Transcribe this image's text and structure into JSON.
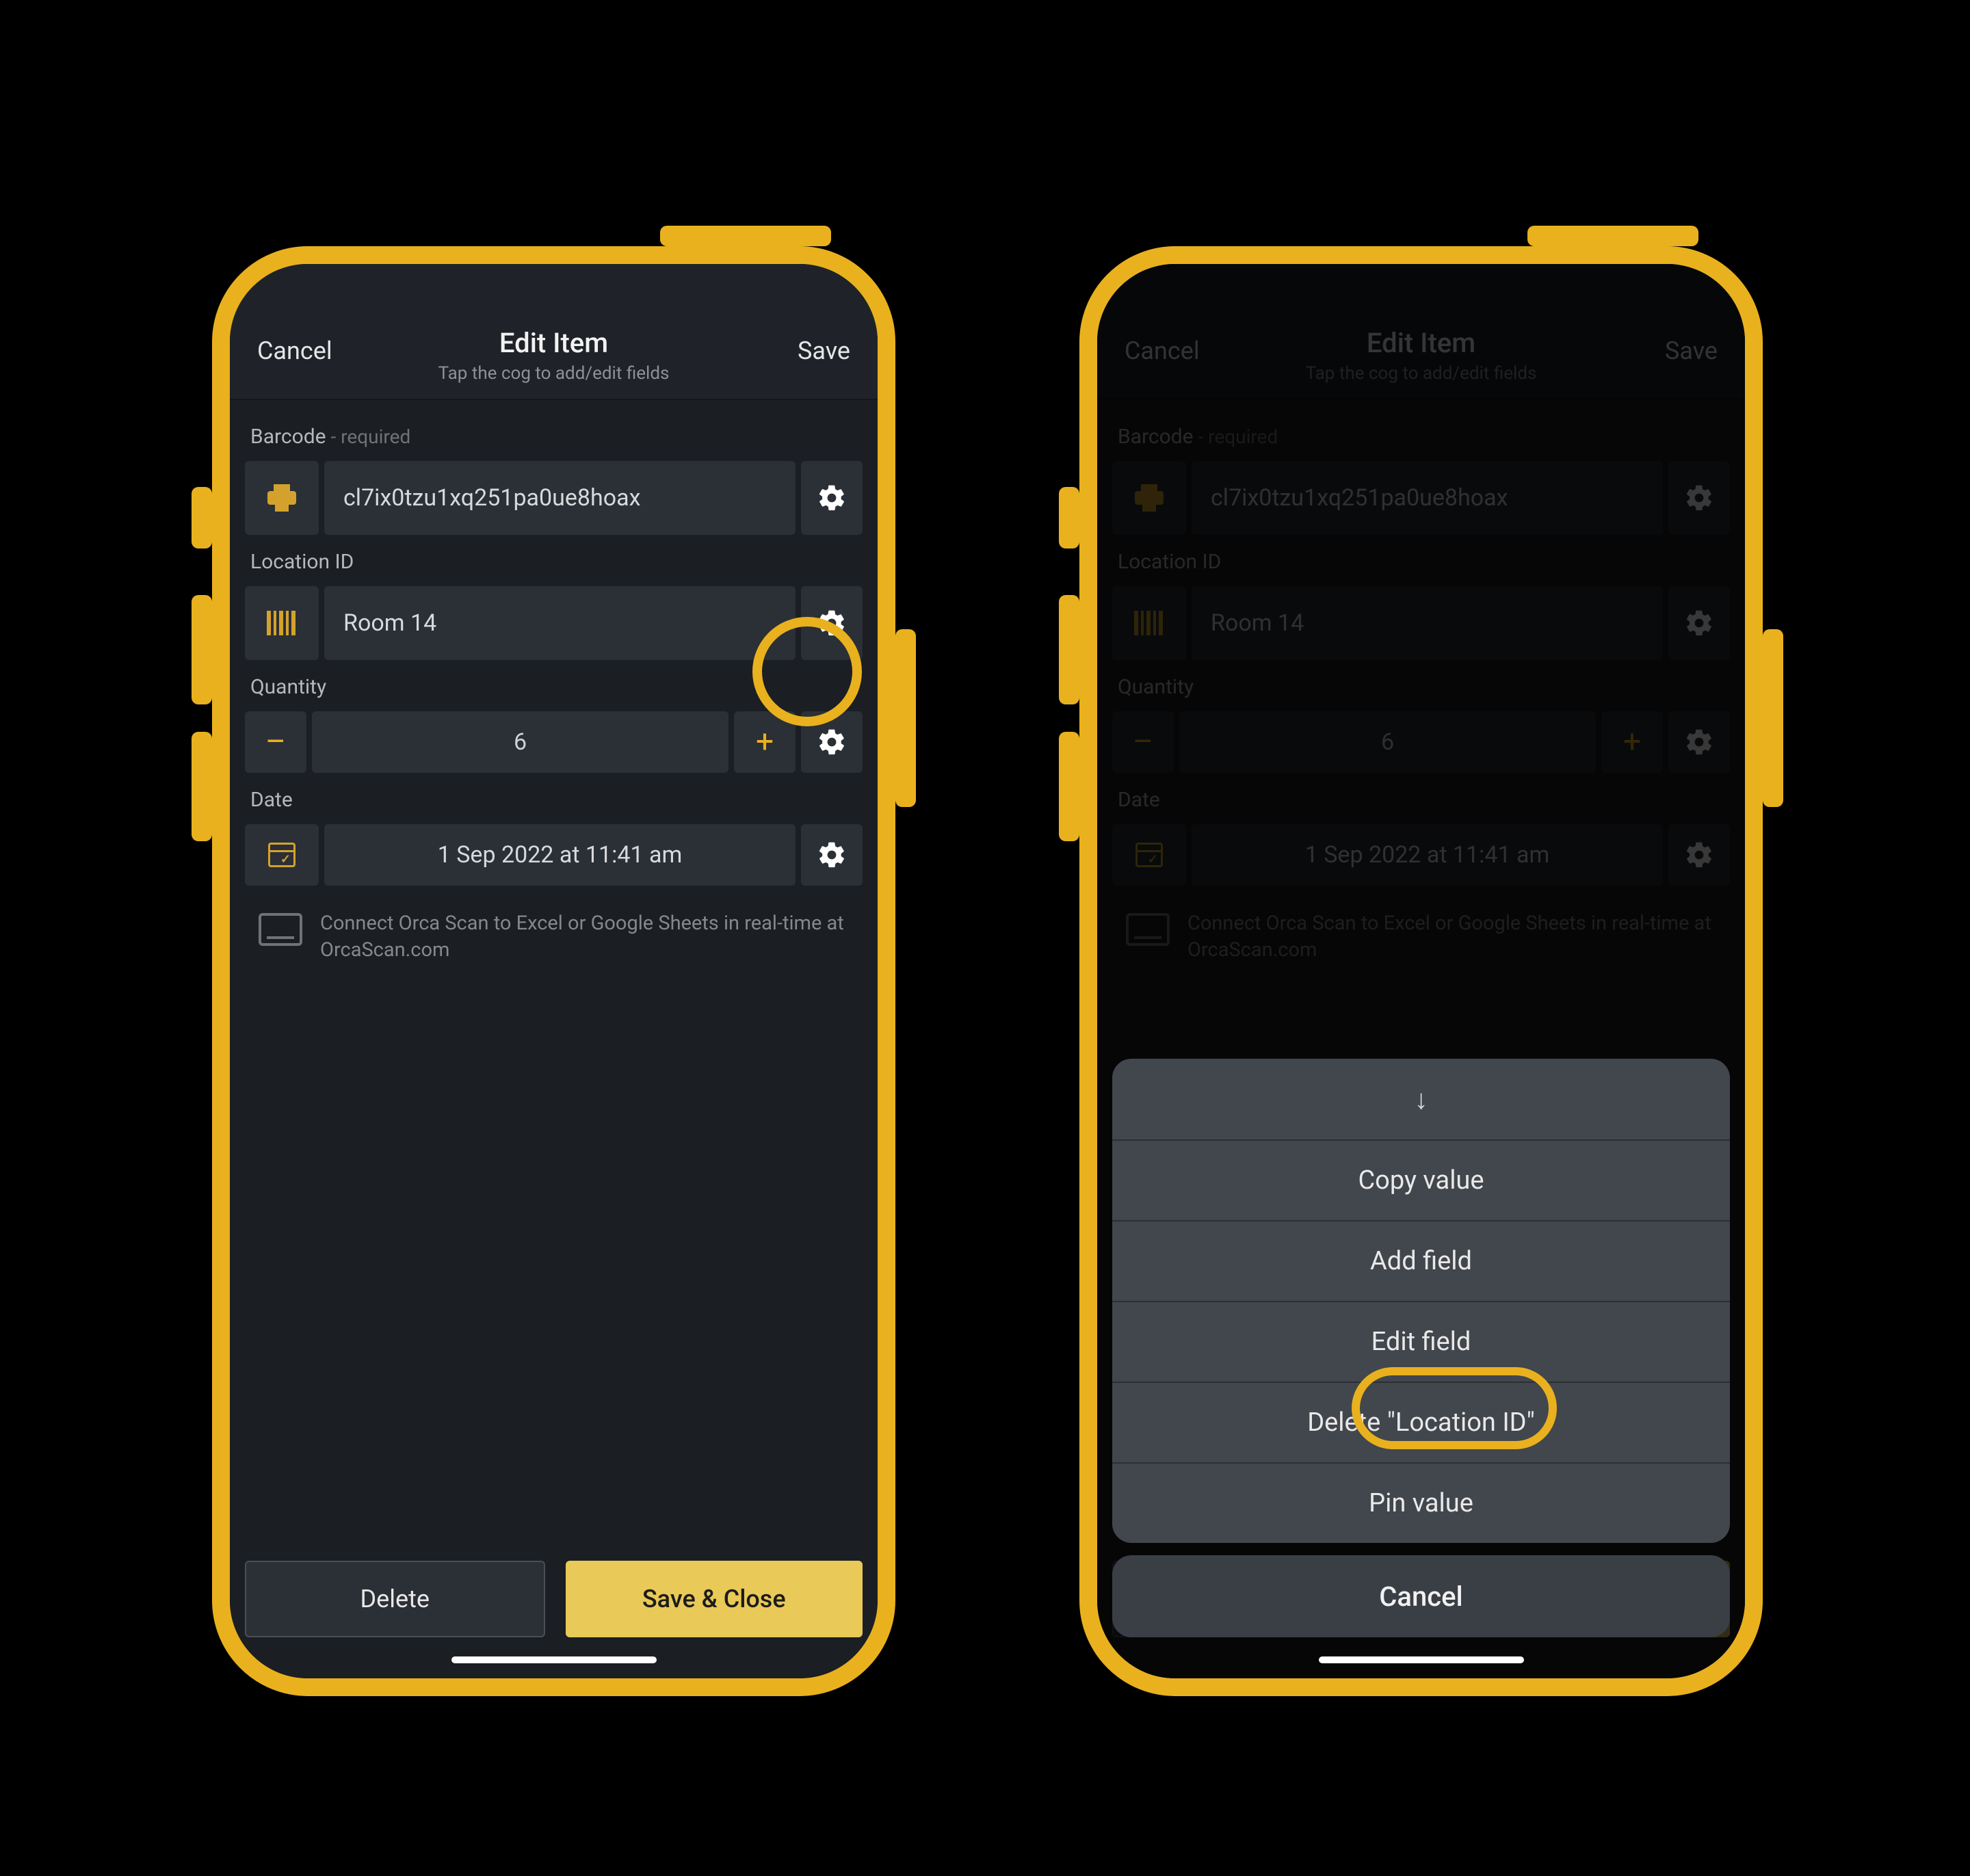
{
  "colors": {
    "accent": "#e9b11e",
    "surface": "#2b2f36",
    "bg": "#1b1e23"
  },
  "header": {
    "cancel": "Cancel",
    "title": "Edit Item",
    "subtitle": "Tap the cog to add/edit fields",
    "save": "Save"
  },
  "fields": {
    "barcode": {
      "label": "Barcode",
      "req": " - required",
      "value": "cl7ix0tzu1xq251pa0ue8hoax",
      "left_icon": "print-icon",
      "gear_icon": "gear-icon"
    },
    "location": {
      "label": "Location ID",
      "value": "Room 14",
      "left_icon": "barcode-icon",
      "gear_icon": "gear-icon"
    },
    "quantity": {
      "label": "Quantity",
      "value": "6",
      "minus": "–",
      "plus": "+",
      "gear_icon": "gear-icon"
    },
    "date": {
      "label": "Date",
      "value": "1 Sep 2022 at 11:41 am",
      "left_icon": "calendar-icon",
      "gear_icon": "gear-icon"
    }
  },
  "promo": "Connect Orca Scan to Excel or Google Sheets in real-time at OrcaScan.com",
  "footer": {
    "delete": "Delete",
    "save_close": "Save & Close"
  },
  "sheet": {
    "arrow_icon": "arrow-down-icon",
    "items": [
      "Copy value",
      "Add field",
      "Edit field",
      "Delete \"Location ID\"",
      "Pin value"
    ],
    "cancel": "Cancel"
  }
}
